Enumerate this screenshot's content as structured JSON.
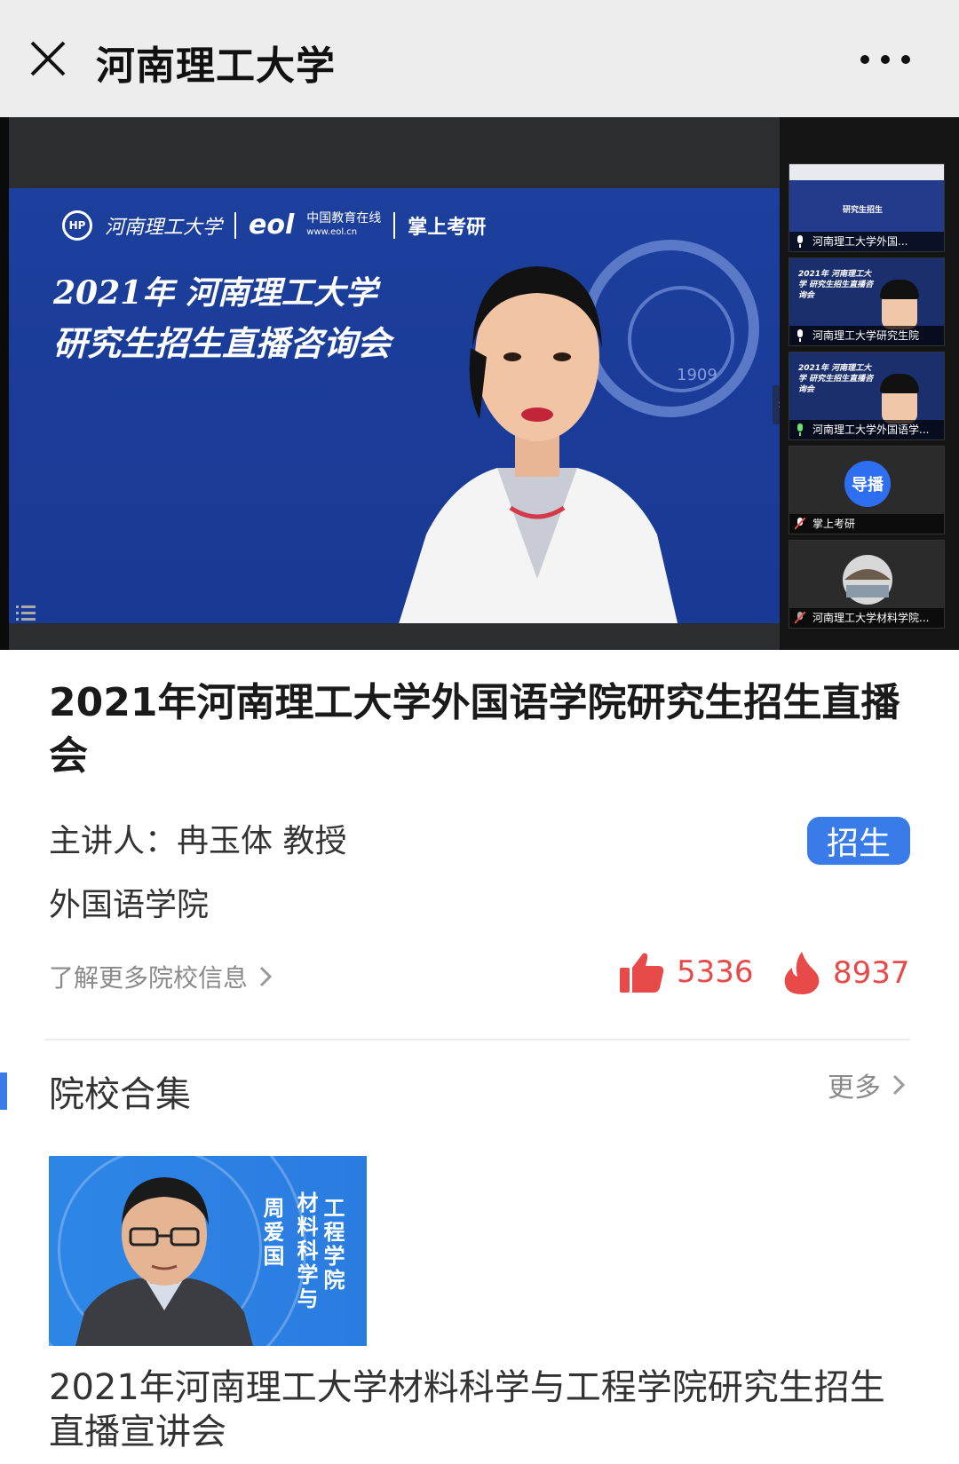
{
  "topbar": {
    "title": "河南理工大学"
  },
  "video": {
    "slide": {
      "logo_school": "河南理工大学",
      "logo_eol": "eol",
      "logo_eol_sub": "中国教育在线",
      "logo_eol_url": "www.eol.cn",
      "logo_app": "掌上考研",
      "title_line1": "2021年 河南理工大学",
      "title_line2": "研究生招生直播咨询会",
      "seal_year": "1909"
    },
    "thumbnails": [
      {
        "label": "河南理工大学外国...",
        "text": "研究生招生"
      },
      {
        "label": "河南理工大学研究生院",
        "text": "2021年 河南理工大学 研究生招生直播咨询会"
      },
      {
        "label": "河南理工大学外国语学...",
        "text": "2021年 河南理工大学 研究生招生直播咨询会"
      },
      {
        "label": "掌上考研",
        "text": "导播"
      },
      {
        "label": "河南理工大学材料学院..."
      }
    ]
  },
  "live": {
    "title": "2021年河南理工大学外国语学院研究生招生直播会",
    "speaker": "主讲人：冉玉体 教授",
    "tag": "招生",
    "college": "外国语学院",
    "learn_more": "了解更多院校信息",
    "likes": "5336",
    "hot": "8937"
  },
  "collection": {
    "title": "院校合集",
    "more": "更多",
    "card": {
      "thumb_name": "周爱国",
      "thumb_col1": "材料科学与",
      "thumb_col2": "工程学院",
      "title": "2021年河南理工大学材料科学与工程学院研究生招生直播宣讲会"
    }
  },
  "colors": {
    "accent": "#3a7bea",
    "stat_red": "#e84a4a",
    "slide_blue": "#1d3f9d"
  }
}
